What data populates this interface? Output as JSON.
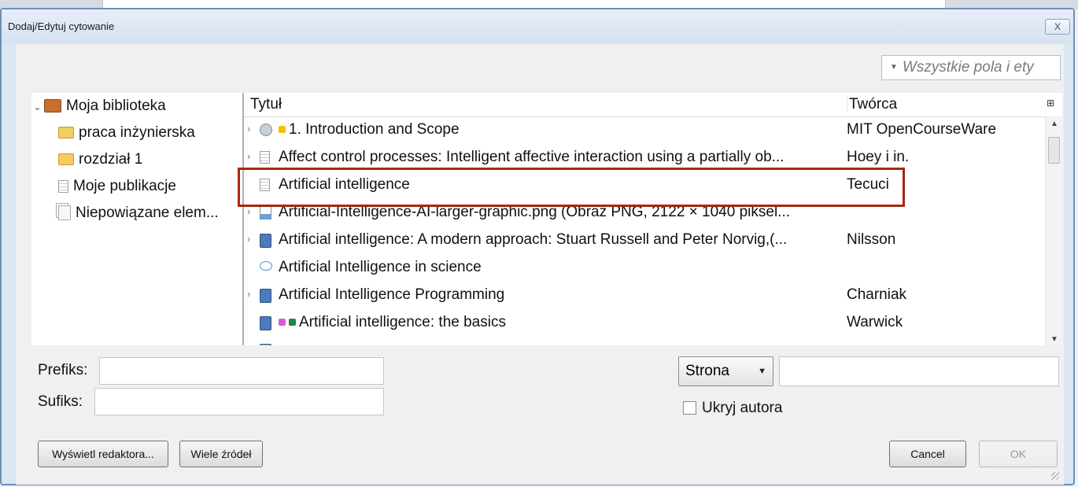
{
  "dialog": {
    "title": "Dodaj/Edytuj cytowanie",
    "close_label": "X"
  },
  "search": {
    "placeholder": "Wszystkie pola i ety"
  },
  "collections": [
    {
      "label": "Moja biblioteka",
      "icon": "library-icon"
    },
    {
      "label": "praca inżynierska",
      "icon": "folder-icon"
    },
    {
      "label": "rozdział 1",
      "icon": "folder-icon"
    },
    {
      "label": "Moje publikacje",
      "icon": "document-icon"
    },
    {
      "label": "Niepowiązane elem...",
      "icon": "unfiled-items-icon"
    }
  ],
  "items": {
    "columns": {
      "title": "Tytuł",
      "creator": "Twórca"
    },
    "rows": [
      {
        "title": "1. Introduction and Scope",
        "creator": "MIT OpenCourseWare",
        "icon": "person-icon",
        "twisty": true,
        "tags": [
          "#f2c200"
        ]
      },
      {
        "title": "Affect control processes: Intelligent affective interaction using a partially ob...",
        "creator": "Hoey i in.",
        "icon": "document-icon",
        "twisty": true,
        "tags": []
      },
      {
        "title": "Artificial intelligence",
        "creator": "Tecuci",
        "icon": "document-icon",
        "twisty": false,
        "tags": []
      },
      {
        "title": "Artificial-Intelligence-AI-larger-graphic.png (Obraz PNG, 2122 × 1040 piksel...",
        "creator": "",
        "icon": "image-icon",
        "twisty": true,
        "tags": []
      },
      {
        "title": "Artificial intelligence: A modern approach: Stuart Russell and Peter Norvig,(...",
        "creator": "Nilsson",
        "icon": "book-icon",
        "twisty": true,
        "tags": []
      },
      {
        "title": "Artificial Intelligence in science",
        "creator": "",
        "icon": "speech-icon",
        "twisty": false,
        "tags": []
      },
      {
        "title": "Artificial Intelligence Programming",
        "creator": "Charniak",
        "icon": "book-icon",
        "twisty": true,
        "tags": []
      },
      {
        "title": "Artificial intelligence: the basics",
        "creator": "Warwick",
        "icon": "book-icon",
        "twisty": false,
        "tags": [
          "#d65bd6",
          "#1b8a3a"
        ]
      }
    ]
  },
  "form": {
    "prefix_label": "Prefiks:",
    "suffix_label": "Sufiks:",
    "locator_value": "Strona",
    "hide_author_label": "Ukryj autora"
  },
  "buttons": {
    "editor": "Wyświetl redaktora...",
    "multiple": "Wiele źródeł",
    "cancel": "Cancel",
    "ok": "OK"
  },
  "colors": {
    "highlight": "#a5280f",
    "tag_yellow": "#f2c200",
    "tag_purple": "#d65bd6",
    "tag_green": "#1b8a3a"
  }
}
